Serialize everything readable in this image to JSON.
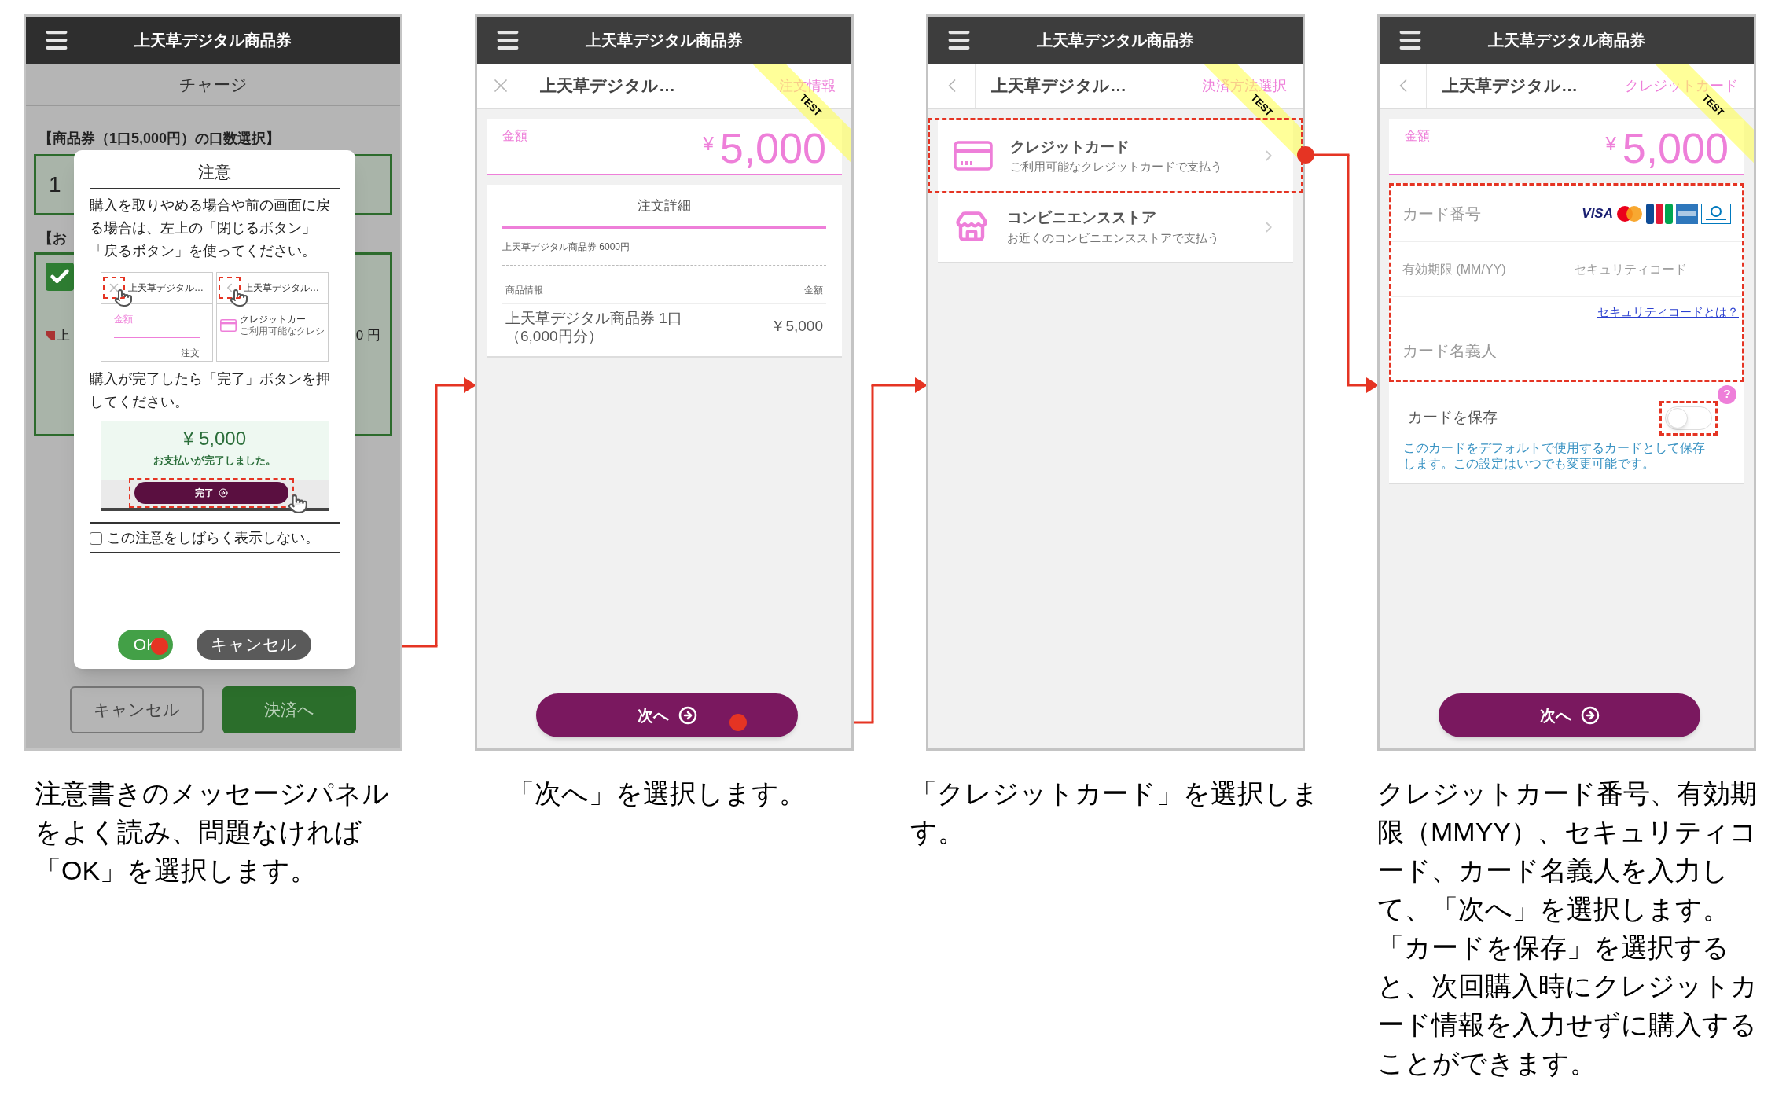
{
  "steps": [
    {
      "kind": "notice",
      "app_title": "上天草デジタル商品券",
      "page_title": "チャージ",
      "quantity_label": "【商品券（1口5,000円）の口数選択】",
      "quantity_value": "1",
      "payment_label": "【お",
      "payment_checked": true,
      "item_text": "上",
      "item_amount": "0 円",
      "buttons": [
        {
          "label": "キャンセル",
          "kind": "secondary"
        },
        {
          "label": "決済へ",
          "kind": "primary"
        }
      ],
      "modal": {
        "title": "注意",
        "message": "購入を取りやめる場合や前の画面に戻る場合は、左上の「閉じるボタン」「戻るボタン」を使ってください。",
        "previews": [
          {
            "kind": "close",
            "title": "上天草デジタル…",
            "line_1": "金額",
            "line_2": "注文"
          },
          {
            "kind": "back",
            "title": "上天草デジタル…",
            "line_1": "クレジットカー",
            "line_2": "ご利用可能なクレシ"
          }
        ],
        "message_2": "購入が完了したら「完了」ボタンを押してください。",
        "done_amount": "¥ 5,000",
        "done_message": "お支払いが完了しました。",
        "done_button": "完了",
        "dont_show": {
          "label": "この注意をしばらく表示しない。",
          "checked": false
        },
        "ok": "OK",
        "cancel": "キャンセル"
      },
      "caption": "注意書きのメッセージパネルをよく読み、問題なければ「OK」を選択します。"
    },
    {
      "kind": "order",
      "app_title": "上天草デジタル商品券",
      "nav": {
        "kind": "close",
        "title": "上天草デジタル…",
        "step": "注文情報"
      },
      "ribbon": "TEST",
      "amount": {
        "label": "金額",
        "currency": "¥",
        "value": "5,000"
      },
      "details": {
        "title": "注文詳細",
        "summary": "上天草デジタル商品券 6000円",
        "columns": [
          "商品情報",
          "金額"
        ],
        "rows": [
          {
            "name": "上天草デジタル商品券 1口（6,000円分）",
            "price": "￥5,000"
          }
        ]
      },
      "next_button": "次へ",
      "caption": "「次へ」を選択します。"
    },
    {
      "kind": "methods",
      "app_title": "上天草デジタル商品券",
      "nav": {
        "kind": "back",
        "title": "上天草デジタル…",
        "step": "決済方法選択"
      },
      "ribbon": "TEST",
      "methods": [
        {
          "kind": "card",
          "title": "クレジットカード",
          "subtitle": "ご利用可能なクレジットカードで支払う",
          "highlighted": true
        },
        {
          "kind": "store",
          "title": "コンビニエンスストア",
          "subtitle": "お近くのコンビニエンスストアで支払う",
          "highlighted": false
        }
      ],
      "caption": "「クレジットカード」を選択します。"
    },
    {
      "kind": "card_form",
      "app_title": "上天草デジタル商品券",
      "nav": {
        "kind": "back",
        "title": "上天草デジタル…",
        "step": "クレジットカード"
      },
      "ribbon": "TEST",
      "amount": {
        "label": "金額",
        "currency": "¥",
        "value": "5,000"
      },
      "form": {
        "card_number_placeholder": "カード番号",
        "brand": "VISA",
        "expiry_placeholder": "有効期限 (MM/YY)",
        "security_code_placeholder": "セキュリティコード",
        "security_link": "セキュリティコードとは？",
        "holder_placeholder": "カード名義人",
        "highlighted": true
      },
      "save": {
        "label": "カードを保存",
        "on": false,
        "highlighted": true,
        "help": "?",
        "note": "このカードをデフォルトで使用するカードとして保存します。この設定はいつでも変更可能です。"
      },
      "next_button": "次へ",
      "caption": "クレジットカード番号、有効期限（MMYY）、セキュリティコード、カード名義人を入力して、「次へ」を選択します。「カードを保存」を選択すると、次回購入時にクレジットカード情報を入力せずに購入することができます。"
    }
  ]
}
